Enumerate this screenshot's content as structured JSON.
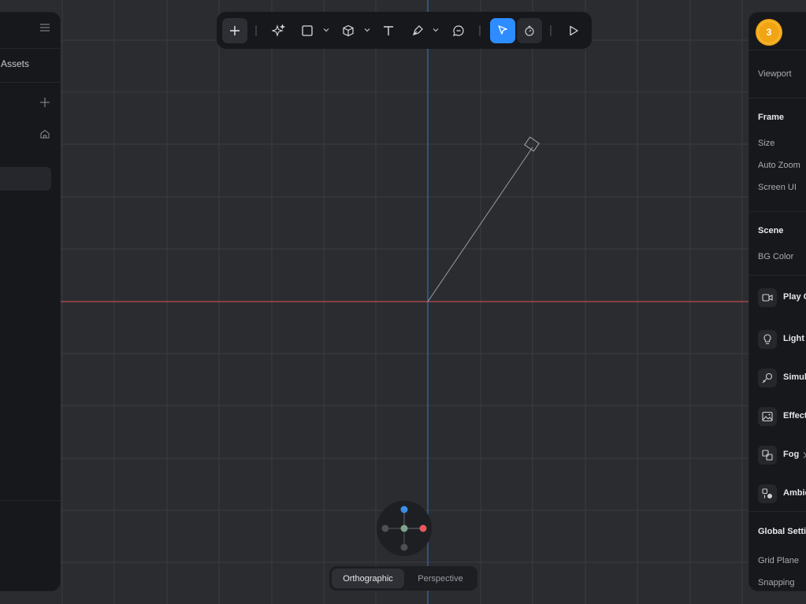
{
  "left_panel": {
    "assets_label": "Assets"
  },
  "toolbar": {
    "tools": [
      "add",
      "ai-sparkle",
      "rectangle",
      "cube",
      "text",
      "pen",
      "comment",
      "select",
      "timer",
      "play"
    ]
  },
  "right_panel": {
    "avatar_count": "3",
    "viewport_label": "Viewport",
    "frame_header": "Frame",
    "size_label": "Size",
    "auto_zoom_label": "Auto Zoom",
    "screen_ui_label": "Screen UI",
    "scene_header": "Scene",
    "bg_color_label": "BG Color",
    "items": {
      "play_camera": "Play C",
      "light": "Light",
      "simulation": "Simul",
      "effects": "Effect",
      "fog": "Fog",
      "ambient": "Ambie"
    },
    "global_settings_header": "Global Setti",
    "grid_plane_label": "Grid Plane",
    "snapping_label": "Snapping"
  },
  "view_mode": {
    "orthographic": "Orthographic",
    "perspective": "Perspective",
    "active": "Orthographic"
  },
  "colors": {
    "accent": "#2d8cff",
    "axis_x": "#e05555",
    "axis_y": "#2d7cd6",
    "avatar": "#f2a413"
  }
}
